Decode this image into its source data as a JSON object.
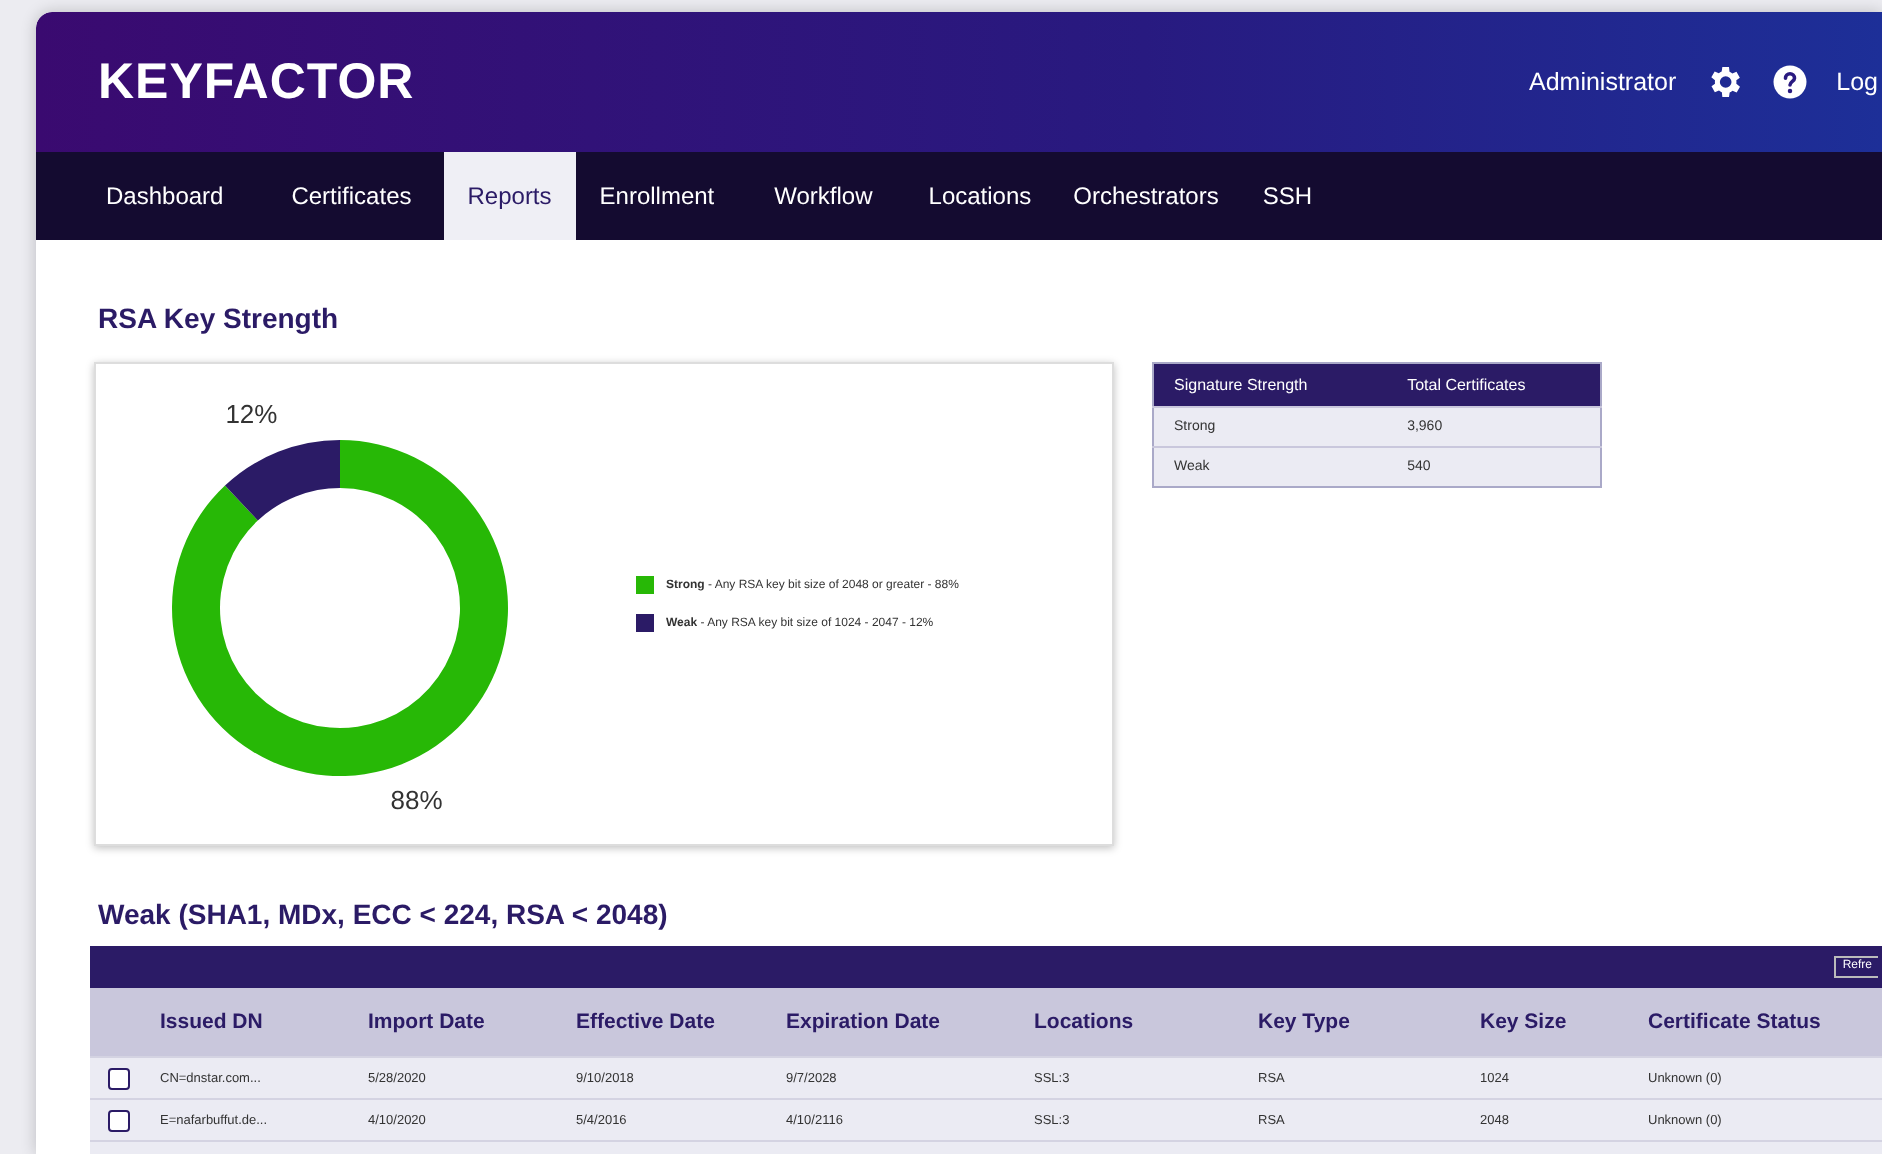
{
  "header": {
    "logo": "KEYFACTOR",
    "user": "Administrator",
    "logout": "Log"
  },
  "nav": [
    {
      "label": "Dashboard",
      "selected": false
    },
    {
      "label": "Certificates",
      "selected": false
    },
    {
      "label": "Reports",
      "selected": true
    },
    {
      "label": "Enrollment",
      "selected": false
    },
    {
      "label": "Workflow",
      "selected": false
    },
    {
      "label": "Locations",
      "selected": false
    },
    {
      "label": "Orchestrators",
      "selected": false
    },
    {
      "label": "SSH",
      "selected": false
    }
  ],
  "strength_section": {
    "title": "RSA Key Strength",
    "chart_data": {
      "type": "donut",
      "categories": [
        "Strong",
        "Weak"
      ],
      "values": [
        88,
        12
      ],
      "value_labels": [
        "88%",
        "12%"
      ]
    },
    "legend": [
      {
        "description": " - Any RSA key bit size of 2048 or greater - 88%",
        "color": "#27b806"
      },
      {
        "description": " - Any RSA key bit size of 1024 - 2047 - 12%",
        "color": "#2b1b66"
      }
    ],
    "summary_table": {
      "columns": [
        "Signature Strength",
        "Total Certificates"
      ],
      "rows": [
        [
          "Strong",
          "3,960"
        ],
        [
          "Weak",
          "540"
        ]
      ]
    }
  },
  "weak_section": {
    "title": "Weak (SHA1, MDx, ECC < 224, RSA < 2048)",
    "refresh": "Refre",
    "columns": [
      "Issued DN",
      "Import Date",
      "Effective Date",
      "Expiration Date",
      "Locations",
      "Key Type",
      "Key Size",
      "Certificate Status"
    ],
    "rows": [
      {
        "checked": false,
        "cells": [
          "CN=dnstar.com...",
          "5/28/2020",
          "9/10/2018",
          "9/7/2028",
          "SSL:3",
          "RSA",
          "1024",
          "Unknown (0)"
        ]
      },
      {
        "checked": false,
        "cells": [
          "E=nafarbuffut.de...",
          "4/10/2020",
          "5/4/2016",
          "4/10/2116",
          "SSL:3",
          "RSA",
          "2048",
          "Unknown (0)"
        ]
      }
    ]
  }
}
